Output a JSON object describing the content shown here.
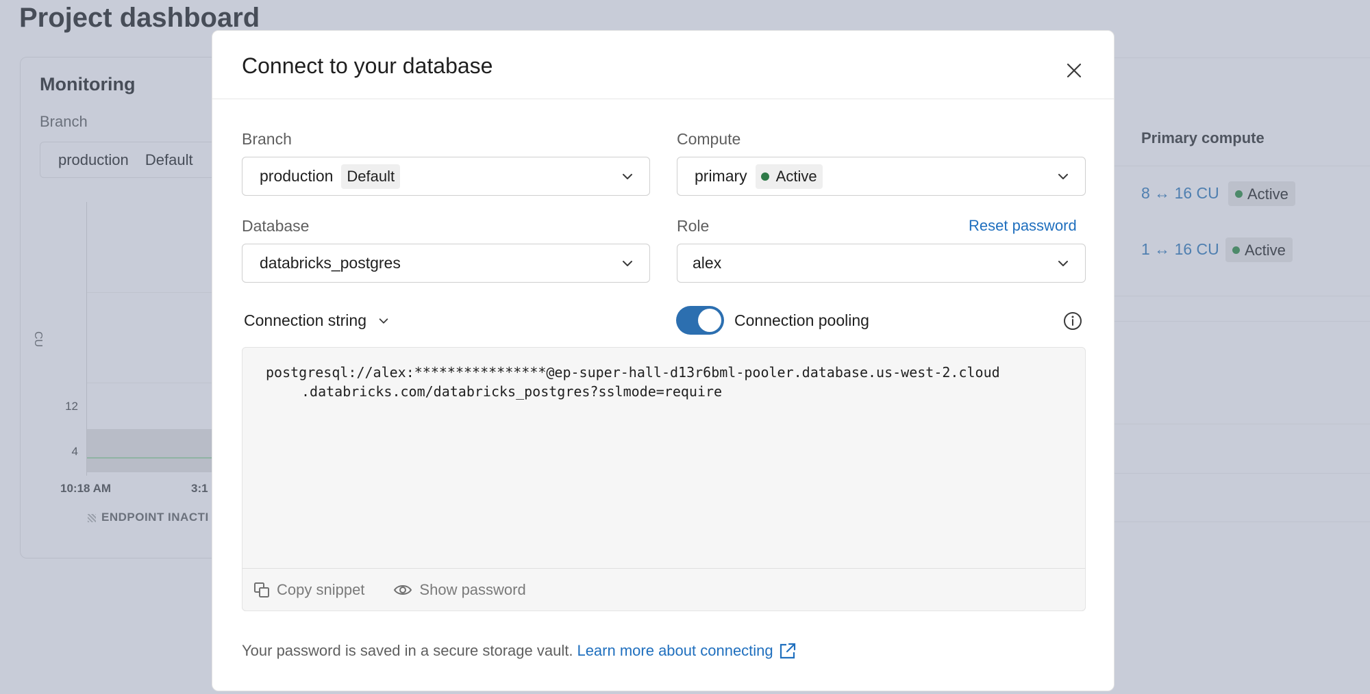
{
  "background": {
    "page_title": "Project dashboard",
    "monitoring": {
      "title": "Monitoring",
      "branch_label": "Branch",
      "branch_value": "production",
      "branch_tag": "Default",
      "y_unit": "CU",
      "y_ticks": [
        "12",
        "4"
      ],
      "x_ticks": [
        "10:18 AM",
        "3:1"
      ],
      "legend": "ENDPOINT INACTI"
    },
    "table": {
      "header": "Primary compute",
      "rows": [
        {
          "range": "8 ↔ 16 CU",
          "status": "Active"
        },
        {
          "range": "1 ↔ 16 CU",
          "status": "Active"
        }
      ]
    }
  },
  "modal": {
    "title": "Connect to your database",
    "branch": {
      "label": "Branch",
      "value": "production",
      "tag": "Default"
    },
    "compute": {
      "label": "Compute",
      "value": "primary",
      "status": "Active"
    },
    "database": {
      "label": "Database",
      "value": "databricks_postgres"
    },
    "role": {
      "label": "Role",
      "value": "alex",
      "reset_link": "Reset password"
    },
    "connection_type": "Connection string",
    "pooling": {
      "label": "Connection pooling",
      "enabled": true
    },
    "code_lines": [
      "postgresql://alex:****************@ep-super-hall-d13r6bml-pooler.database.us-west-2.cloud",
      ".databricks.com/databricks_postgres?sslmode=require"
    ],
    "copy_label": "Copy snippet",
    "show_password_label": "Show password",
    "footer_text": "Your password is saved in a secure storage vault.",
    "footer_link": "Learn more about connecting"
  },
  "colors": {
    "accent": "#2c6fb0",
    "link": "#1f6fbe",
    "status_active": "#2f7a48",
    "overlay": "#c8ccd8"
  },
  "icons": [
    "close-icon",
    "chevron-down-icon",
    "info-icon",
    "copy-icon",
    "eye-icon",
    "external-link-icon"
  ]
}
